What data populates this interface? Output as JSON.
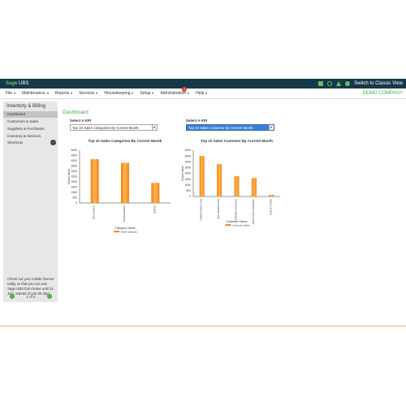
{
  "header": {
    "brand_sage": "Sage",
    "brand_product": " UBS",
    "classic_view_label": "Switch to Classic View",
    "icons": [
      "save-icon",
      "refresh-icon",
      "home-icon",
      "power-icon"
    ]
  },
  "menu": {
    "items": [
      {
        "label": "File"
      },
      {
        "label": "Maintenance"
      },
      {
        "label": "Reports"
      },
      {
        "label": "Services"
      },
      {
        "label": "Housekeeping"
      },
      {
        "label": "Setup"
      },
      {
        "label": "Administration",
        "badge": "1"
      },
      {
        "label": "Help"
      }
    ],
    "company": "DEMO COMPANY"
  },
  "sidebar": {
    "title": "Inventory & Billing",
    "items": [
      {
        "label": "Dashboard",
        "active": true
      },
      {
        "label": "Customers & Sales"
      },
      {
        "label": "Suppliers & Purchases"
      },
      {
        "label": "Inventory & Services"
      },
      {
        "label": "Shortcuts"
      }
    ],
    "promo": "Check out your mobile licence today so that you can use Sage UBS from home until 31 July, instead of just 30 days.",
    "pager": {
      "prev": "‹",
      "text": "1 of 4",
      "next": "›"
    }
  },
  "main": {
    "title": "Dashboard",
    "kpi_left": {
      "label": "Select A KPI",
      "value": "Top 10 Sales Categories By Current Month"
    },
    "kpi_right": {
      "label": "Select A KPI",
      "value": "Top 10 Sales Customer By Current Month"
    }
  },
  "colors": {
    "accent": "#43b049",
    "bar": "#f57f17",
    "bar_highlight": "#ffb74d",
    "topbar": "#16394a"
  },
  "chart_data": [
    {
      "type": "bar",
      "title": "Top 10 Sales Categories By Current Month",
      "xlabel": "Category Name",
      "ylabel": "Grand Value",
      "categories": [
        "GOLF BALLS",
        "ACCESSORIES",
        "SHIRTS"
      ],
      "series": [
        {
          "name": "Sales Category",
          "values": [
            4150,
            3800,
            1900
          ]
        }
      ],
      "ylim": [
        0,
        5000
      ],
      "yticks": [
        0,
        500,
        1000,
        1500,
        2000,
        2500,
        3000,
        3500,
        4000,
        4500,
        5000
      ],
      "legend": "bottom"
    },
    {
      "type": "bar",
      "title": "Top 10 Sales Customer By Current Month",
      "xlabel": "Customer Name",
      "ylabel": "Grand Value",
      "categories": [
        "GREEN PARK CLUB",
        "ACE SPORTS BHD",
        "FAIRWAY SUPPLIES",
        "LINKS GOLF COMPANY",
        "EAGLE STORE"
      ],
      "series": [
        {
          "name": "Customer Sales",
          "values": [
            3500,
            2800,
            1750,
            1600,
            150
          ]
        }
      ],
      "ylim": [
        0,
        4000
      ],
      "yticks": [
        0,
        500,
        1000,
        1500,
        2000,
        2500,
        3000,
        3500,
        4000
      ],
      "legend": "bottom"
    }
  ]
}
